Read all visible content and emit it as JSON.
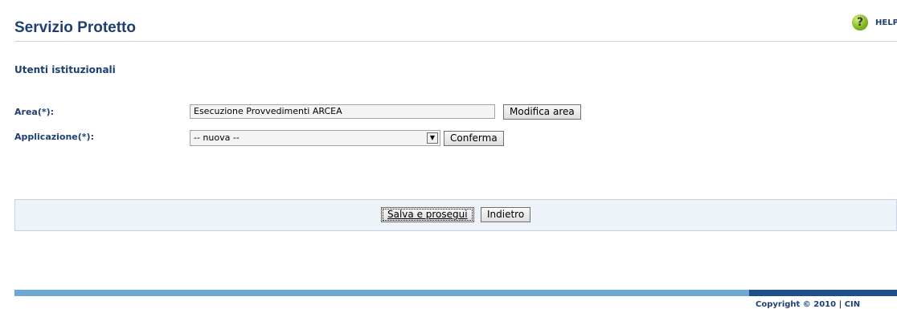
{
  "header": {
    "title": "Servizio Protetto",
    "help_label": "HELP",
    "help_icon": "question-mark-icon",
    "help_icon_glyph": "?"
  },
  "section": {
    "title": "Utenti istituzionali"
  },
  "form": {
    "area_label": "Area(*):",
    "area_value": "Esecuzione Provvedimenti ARCEA",
    "modifica_area_label": "Modifica area",
    "applicazione_label": "Applicazione(*):",
    "applicazione_selected": "-- nuova --",
    "conferma_label": "Conferma"
  },
  "actions": {
    "salva_label": "Salva e prosegui",
    "indietro_label": "Indietro"
  },
  "footer": {
    "copyright": "Copyright © 2010 | CIN"
  },
  "colors": {
    "heading": "#1f3f73",
    "rule": "#c9d6e6",
    "action_bar_bg": "#eef3f9",
    "footer_light": "#6ea9d6",
    "footer_dark": "#1d4f8a"
  }
}
